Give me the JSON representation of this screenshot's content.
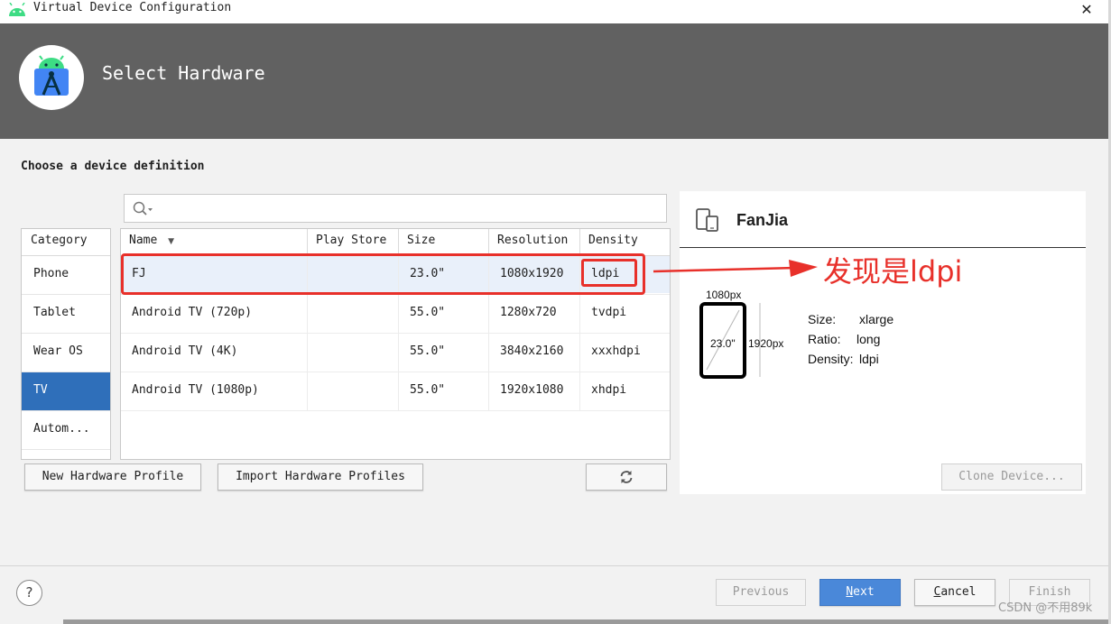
{
  "window": {
    "title": "Virtual Device Configuration",
    "close_glyph": "✕"
  },
  "header": {
    "title": "Select Hardware"
  },
  "section": {
    "title": "Choose a device definition"
  },
  "search": {
    "placeholder": ""
  },
  "category": {
    "header": "Category",
    "items": [
      "Phone",
      "Tablet",
      "Wear OS",
      "TV",
      "Autom..."
    ],
    "selected": "TV"
  },
  "table": {
    "columns": [
      "Name",
      "Play Store",
      "Size",
      "Resolution",
      "Density"
    ],
    "sort_glyph": "▼",
    "rows": [
      {
        "name": "FJ",
        "play_store": "",
        "size": "23.0\"",
        "resolution": "1080x1920",
        "density": "ldpi"
      },
      {
        "name": "Android TV (720p)",
        "play_store": "",
        "size": "55.0\"",
        "resolution": "1280x720",
        "density": "tvdpi"
      },
      {
        "name": "Android TV (4K)",
        "play_store": "",
        "size": "55.0\"",
        "resolution": "3840x2160",
        "density": "xxxhdpi"
      },
      {
        "name": "Android TV (1080p)",
        "play_store": "",
        "size": "55.0\"",
        "resolution": "1920x1080",
        "density": "xhdpi"
      }
    ]
  },
  "buttons": {
    "new_profile": "New Hardware Profile",
    "import_profiles": "Import Hardware Profiles",
    "clone": "Clone Device...",
    "previous": "Previous",
    "next_mnemonic": "N",
    "next_rest": "ext",
    "cancel_mnemonic": "C",
    "cancel_rest": "ancel",
    "finish": "Finish",
    "help": "?"
  },
  "details": {
    "name": "FanJia",
    "width_px": "1080px",
    "height_px": "1920px",
    "diagonal": "23.0\"",
    "size_label": "Size:",
    "size_value": "xlarge",
    "ratio_label": "Ratio:",
    "ratio_value": "long",
    "density_label": "Density:",
    "density_value": "ldpi"
  },
  "annotation": {
    "text": "发现是ldpi",
    "color": "#e8302a"
  },
  "watermark": {
    "text": "CSDN @不用89k"
  },
  "colors": {
    "header_bg": "#616161",
    "selection": "#2f6fba",
    "primary_button": "#4a88d9",
    "annotation": "#e8302a"
  }
}
